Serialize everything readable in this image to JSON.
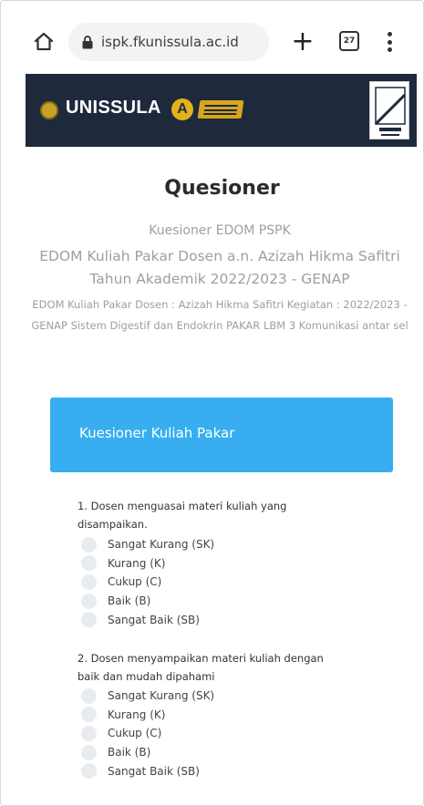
{
  "browser": {
    "url": "ispk.fkunissula.ac.id",
    "tab_count": "27",
    "icons": [
      "home-icon",
      "lock-icon",
      "plus-icon",
      "tab-switcher-icon",
      "more-vert-icon"
    ]
  },
  "header": {
    "brand": "UNISSULA",
    "brand_initial": "A",
    "colors": {
      "banner": "#1e2a3c",
      "accent": "#e2b21d"
    }
  },
  "page": {
    "title": "Quesioner",
    "subtitle_1": "Kuesioner EDOM PSPK",
    "subtitle_2": "EDOM Kuliah Pakar Dosen a.n. Azizah Hikma Safitri Tahun Akademik 2022/2023 - GENAP",
    "subtitle_3": "EDOM Kuliah Pakar Dosen : Azizah Hikma Safitri Kegiatan : 2022/2023 - GENAP Sistem Digestif dan Endokrin PAKAR LBM 3 Komunikasi antar sel"
  },
  "card": {
    "title": "Kuesioner Kuliah Pakar",
    "colors": {
      "header": "#38aef0"
    }
  },
  "questions": [
    {
      "text": "1. Dosen menguasai materi kuliah yang disampaikan.",
      "options": [
        "Sangat Kurang (SK)",
        "Kurang (K)",
        "Cukup (C)",
        "Baik (B)",
        "Sangat Baik (SB)"
      ]
    },
    {
      "text": "2. Dosen menyampaikan materi kuliah dengan baik dan mudah dipahami",
      "options": [
        "Sangat Kurang (SK)",
        "Kurang (K)",
        "Cukup (C)",
        "Baik (B)",
        "Sangat Baik (SB)"
      ]
    }
  ]
}
